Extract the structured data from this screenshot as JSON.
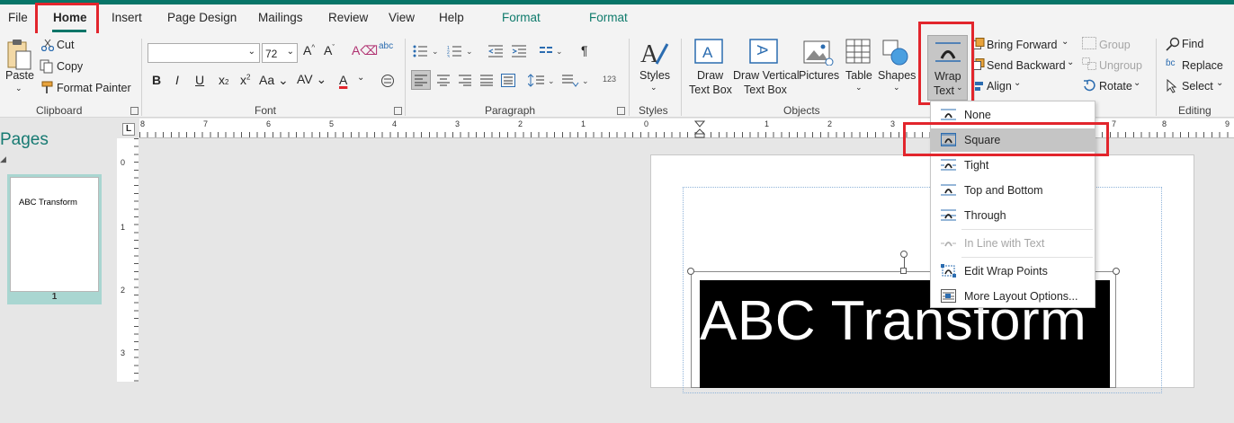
{
  "tabs": [
    {
      "label": "File"
    },
    {
      "label": "Home"
    },
    {
      "label": "Insert"
    },
    {
      "label": "Page Design"
    },
    {
      "label": "Mailings"
    },
    {
      "label": "Review"
    },
    {
      "label": "View"
    },
    {
      "label": "Help"
    },
    {
      "label": "Format"
    },
    {
      "label": "Format"
    }
  ],
  "clipboard": {
    "paste": "Paste",
    "cut": "Cut",
    "copy": "Copy",
    "format_painter": "Format Painter",
    "group": "Clipboard"
  },
  "font": {
    "size": "72",
    "group": "Font",
    "change_case": "Aa"
  },
  "paragraph": {
    "group": "Paragraph"
  },
  "styles": {
    "label": "Styles",
    "group": "Styles"
  },
  "objects": {
    "draw_text_box": [
      "Draw",
      "Text Box"
    ],
    "draw_vertical": [
      "Draw Vertical",
      "Text Box"
    ],
    "pictures": "Pictures",
    "table": "Table",
    "shapes": "Shapes",
    "wrap_text": [
      "Wrap",
      "Text"
    ],
    "group": "Objects"
  },
  "arrange": {
    "bring_forward": "Bring Forward",
    "send_backward": "Send Backward",
    "align": "Align",
    "group_btn": "Group",
    "ungroup": "Ungroup",
    "rotate": "Rotate"
  },
  "editing": {
    "find": "Find",
    "replace": "Replace",
    "select": "Select",
    "group": "Editing"
  },
  "pages_pane": {
    "title": "Pages",
    "thumb_text": "ABC Transform",
    "page_number": "1"
  },
  "ruler": {
    "h_numbers": [
      "8",
      "7",
      "6",
      "5",
      "4",
      "3",
      "2",
      "1",
      "0",
      "1",
      "2",
      "3",
      "4",
      "5",
      "6",
      "7",
      "8",
      "9"
    ],
    "v_numbers": [
      "0",
      "1",
      "2",
      "3"
    ]
  },
  "document": {
    "text": "ABC Transform"
  },
  "wrap_menu": {
    "items": [
      {
        "label": "None",
        "disabled": false,
        "selected": false
      },
      {
        "label": "Square",
        "disabled": false,
        "selected": true
      },
      {
        "label": "Tight",
        "disabled": false,
        "selected": false
      },
      {
        "label": "Top and Bottom",
        "disabled": false,
        "selected": false
      },
      {
        "label": "Through",
        "disabled": false,
        "selected": false
      },
      {
        "label": "In Line with Text",
        "disabled": true,
        "selected": false
      },
      {
        "label": "Edit Wrap Points",
        "disabled": false,
        "selected": false
      },
      {
        "label": "More Layout Options...",
        "disabled": false,
        "selected": false
      }
    ]
  },
  "colors": {
    "accent": "#077568",
    "highlight_red": "#e2252c",
    "format_tab": "#0f7b6c"
  }
}
